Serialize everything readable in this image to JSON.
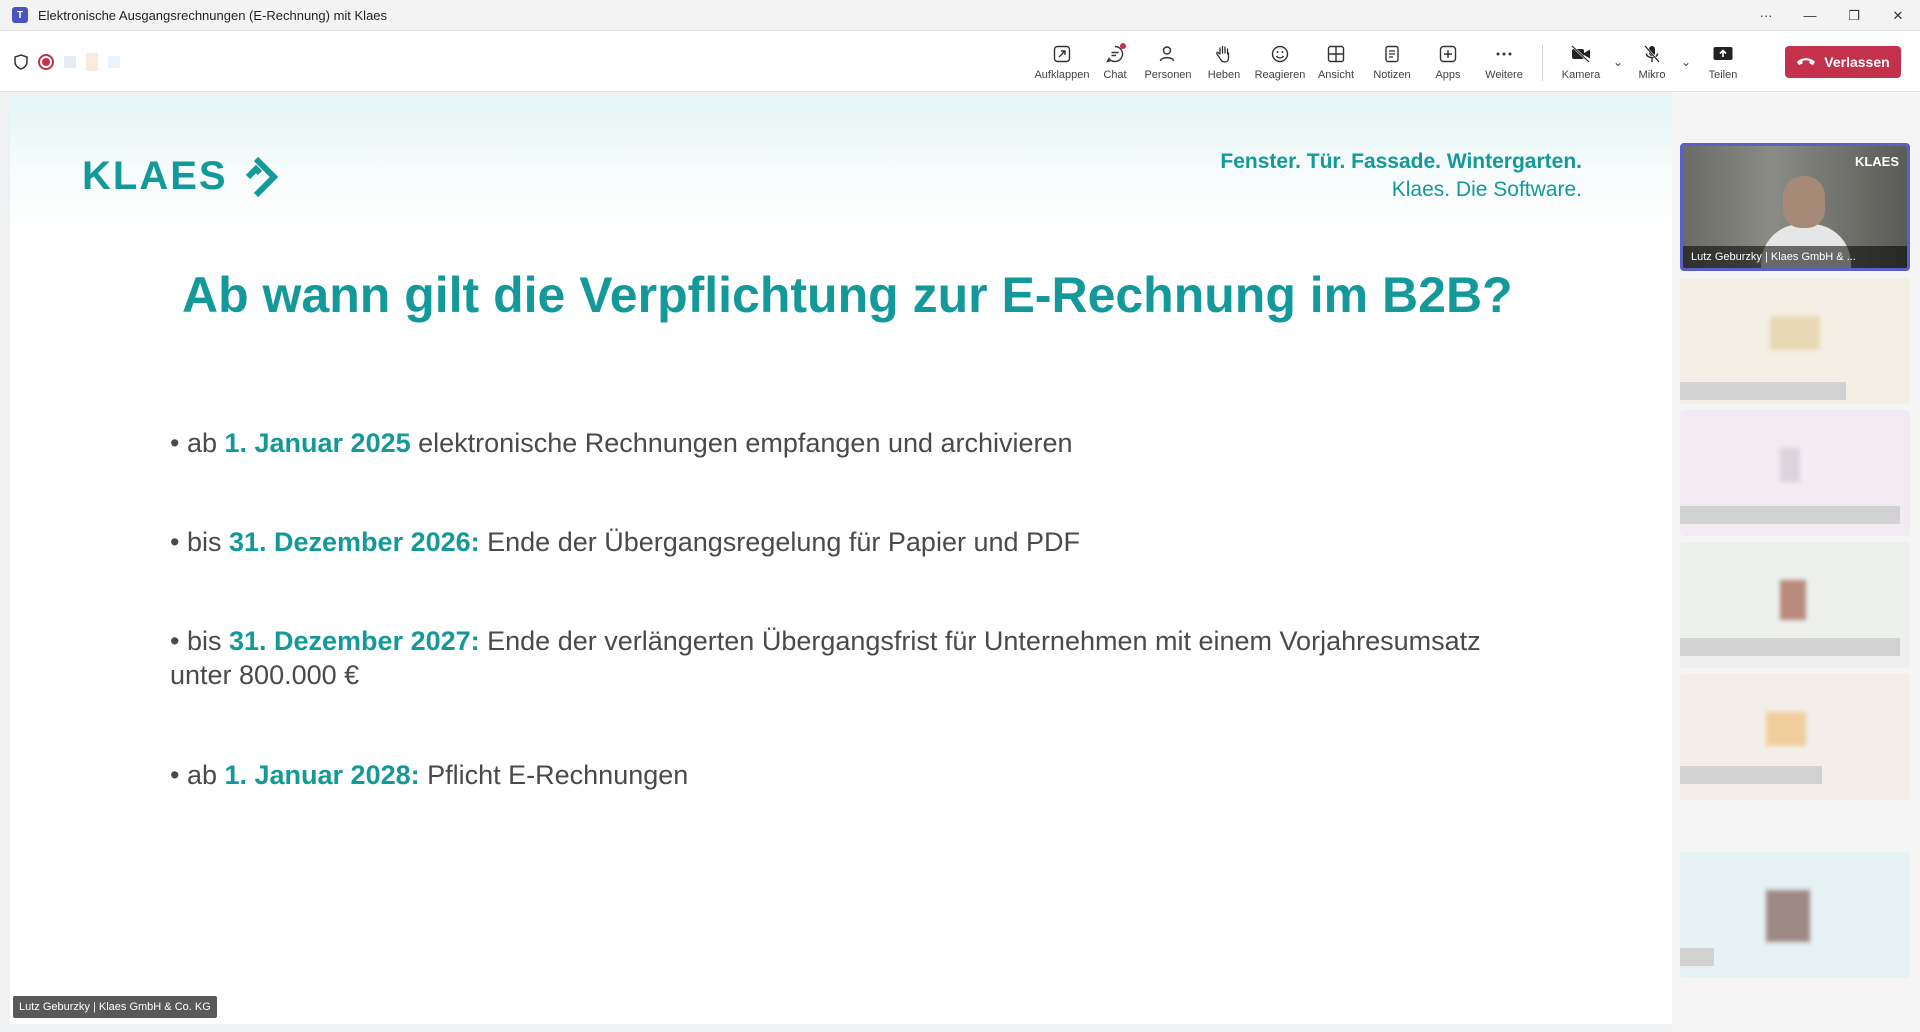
{
  "window": {
    "title": "Elektronische Ausgangsrechnungen (E-Rechnung) mit Klaes",
    "controls": [
      "···",
      "—",
      "❐",
      "✕"
    ]
  },
  "toolbar": {
    "items": [
      {
        "id": "aufklappen",
        "label": "Aufklappen",
        "icon": "expand-icon"
      },
      {
        "id": "chat",
        "label": "Chat",
        "icon": "chat-icon"
      },
      {
        "id": "personen",
        "label": "Personen",
        "icon": "people-icon"
      },
      {
        "id": "heben",
        "label": "Heben",
        "icon": "raise-hand-icon"
      },
      {
        "id": "reagieren",
        "label": "Reagieren",
        "icon": "emoji-icon"
      },
      {
        "id": "ansicht",
        "label": "Ansicht",
        "icon": "grid-icon"
      },
      {
        "id": "notizen",
        "label": "Notizen",
        "icon": "notes-icon"
      },
      {
        "id": "apps",
        "label": "Apps",
        "icon": "add-icon"
      },
      {
        "id": "weitere",
        "label": "Weitere",
        "icon": "more-icon"
      }
    ],
    "kamera_label": "Kamera",
    "mikro_label": "Mikro",
    "teilen_label": "Teilen",
    "leave_label": "Verlassen",
    "accent": "#c4314b"
  },
  "slide": {
    "logo": "KLAES",
    "tagline_1": "Fenster. Tür. Fassade. Wintergarten.",
    "tagline_2": "Klaes. Die Software.",
    "title": "Ab wann gilt die Verpflichtung zur E-Rechnung im B2B?",
    "bullets": [
      {
        "prefix": "• ab ",
        "date": "1. Januar 2025",
        "text": " elektronische Rechnungen empfangen und archivieren"
      },
      {
        "prefix": "• bis ",
        "date": "31. Dezember 2026:",
        "text": " Ende der Übergangsregelung für Papier und PDF"
      },
      {
        "prefix": "• bis ",
        "date": "31. Dezember 2027:",
        "text": " Ende der verlängerten Übergangsfrist für Unternehmen mit einem Vorjahresumsatz",
        "text2": "unter 800.000 €"
      },
      {
        "prefix": "• ab ",
        "date": "1. Januar 2028:",
        "text": " Pflicht E-Rechnungen"
      }
    ],
    "accent": "#14999a"
  },
  "presenter": {
    "name": "Lutz Geburzky | Klaes GmbH & Co. KG",
    "tile_name": "Lutz Geburzky | Klaes GmbH & ...",
    "tile_logo": "KLAES"
  }
}
